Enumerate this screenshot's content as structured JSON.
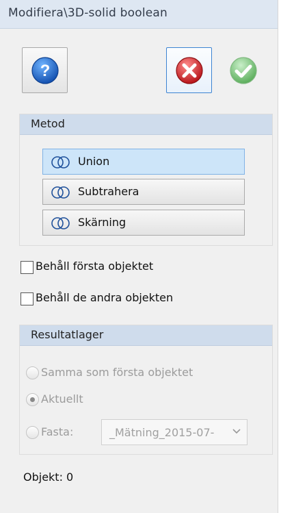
{
  "window": {
    "title": "Modifiera\\3D-solid boolean"
  },
  "toolbar": {
    "help_icon": "help-icon",
    "cancel_icon": "cancel-icon",
    "ok_icon": "ok-checkmark-icon"
  },
  "method": {
    "header": "Metod",
    "options": [
      {
        "label": "Union",
        "selected": true,
        "icon": "union-icon"
      },
      {
        "label": "Subtrahera",
        "selected": false,
        "icon": "subtract-icon"
      },
      {
        "label": "Skärning",
        "selected": false,
        "icon": "intersect-icon"
      }
    ]
  },
  "options": {
    "keep_first": "Behåll första objektet",
    "keep_others": "Behåll de andra objekten"
  },
  "result_layer": {
    "header": "Resultatlager",
    "same_as_first": "Samma som första objektet",
    "current": "Aktuellt",
    "fixed": "Fasta:",
    "fixed_value": "_Mätning_2015-07-",
    "selected": "current"
  },
  "status": {
    "objects": "Objekt: 0"
  },
  "colors": {
    "title_bg": "#dee7f2",
    "group_header_bg": "#cfdcec",
    "selected_bg": "#cde5f9",
    "help_blue": "#1f63c4",
    "cancel_red": "#d63a3a",
    "ok_green": "#6fc36f"
  }
}
